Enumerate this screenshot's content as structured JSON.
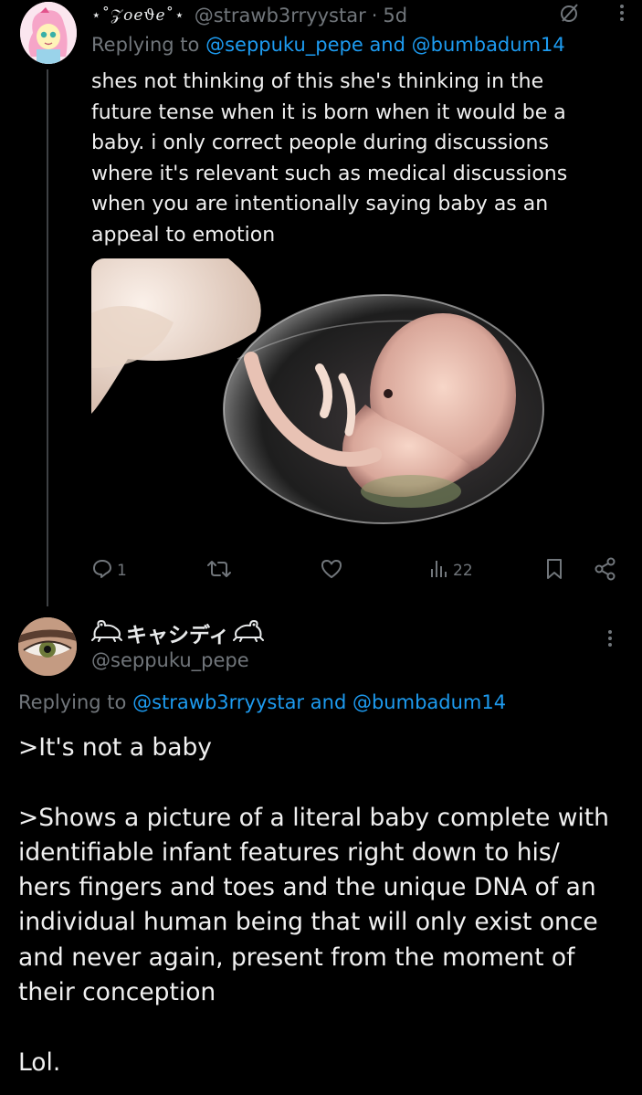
{
  "tweet1": {
    "display_name": "⋆˚𝒵𝑜𝑒ϑℯ˚⋆",
    "handle": "@strawb3rryystar",
    "separator": "·",
    "time": "5d",
    "replying_prefix": "Replying to",
    "mention1": "@seppuku_pepe",
    "and_word": "and",
    "mention2": "@bumbadum14",
    "body_lines": [
      "shes not thinking of this she's thinking in the",
      "future tense when it is born when it would be a",
      "baby. i only correct people during discussions",
      "where it's relevant such as medical discussions",
      "when you are intentionally saying baby as an",
      "appeal to emotion"
    ],
    "counts": {
      "replies": "1",
      "views": "22"
    }
  },
  "tweet2": {
    "display_name": "キャシディ",
    "handle": "@seppuku_pepe",
    "replying_prefix": "Replying to",
    "mention1": "@strawb3rryystar",
    "and_word": "and",
    "mention2": "@bumbadum14",
    "body_lines": [
      ">It's not a baby",
      "",
      ">Shows a picture of a literal baby complete with",
      "identifiable infant features right down to his/",
      "hers fingers and toes and the unique DNA of an",
      "individual human being that will only exist once",
      "and never again, present from the moment of",
      "their conception",
      "",
      "Lol."
    ]
  },
  "icons": {
    "reply": "comment-bubble-icon",
    "retweet": "retweet-icon",
    "like": "heart-icon",
    "views": "bar-chart-icon",
    "bookmark": "bookmark-icon",
    "share": "share-icon",
    "grok": "slash-circle-icon",
    "more": "vertical-dots-icon",
    "frog": "frog-emoji-icon"
  },
  "colors": {
    "background": "#000000",
    "text": "#e7e9ea",
    "secondary": "#71767b",
    "link": "#1d9bf0",
    "thread_line": "#3e4144"
  }
}
